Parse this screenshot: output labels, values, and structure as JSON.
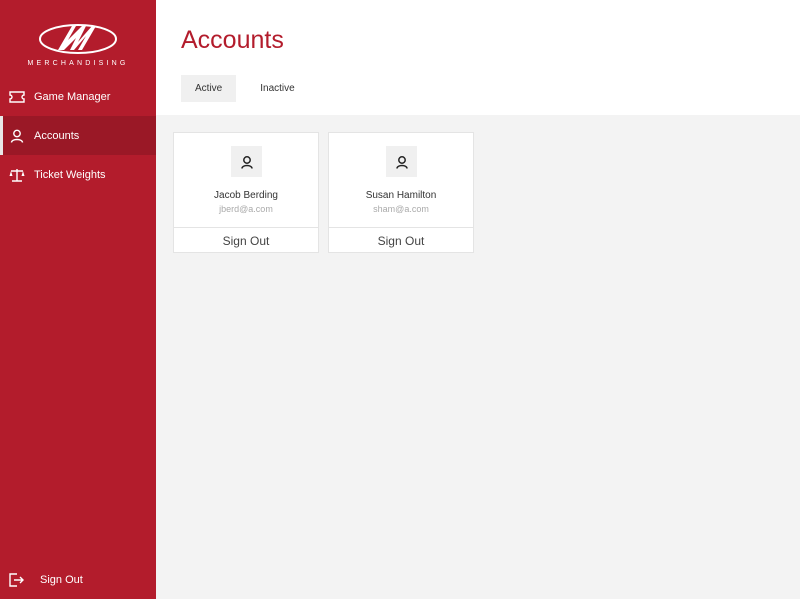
{
  "brand": {
    "logo_text": "MERCHANDISING"
  },
  "sidebar": {
    "items": [
      {
        "label": "Game Manager",
        "icon": "ticket-icon"
      },
      {
        "label": "Accounts",
        "icon": "user-icon"
      },
      {
        "label": "Ticket Weights",
        "icon": "scale-icon"
      }
    ],
    "signout_label": "Sign Out"
  },
  "header": {
    "title": "Accounts",
    "tabs": [
      {
        "label": "Active"
      },
      {
        "label": "Inactive"
      }
    ]
  },
  "accounts": [
    {
      "name": "Jacob Berding",
      "email": "jberd@a.com",
      "action": "Sign Out"
    },
    {
      "name": "Susan Hamilton",
      "email": "sham@a.com",
      "action": "Sign Out"
    }
  ],
  "colors": {
    "brand": "#b31c2c",
    "brand_dark": "#9a1826",
    "background": "#f3f3f3"
  }
}
